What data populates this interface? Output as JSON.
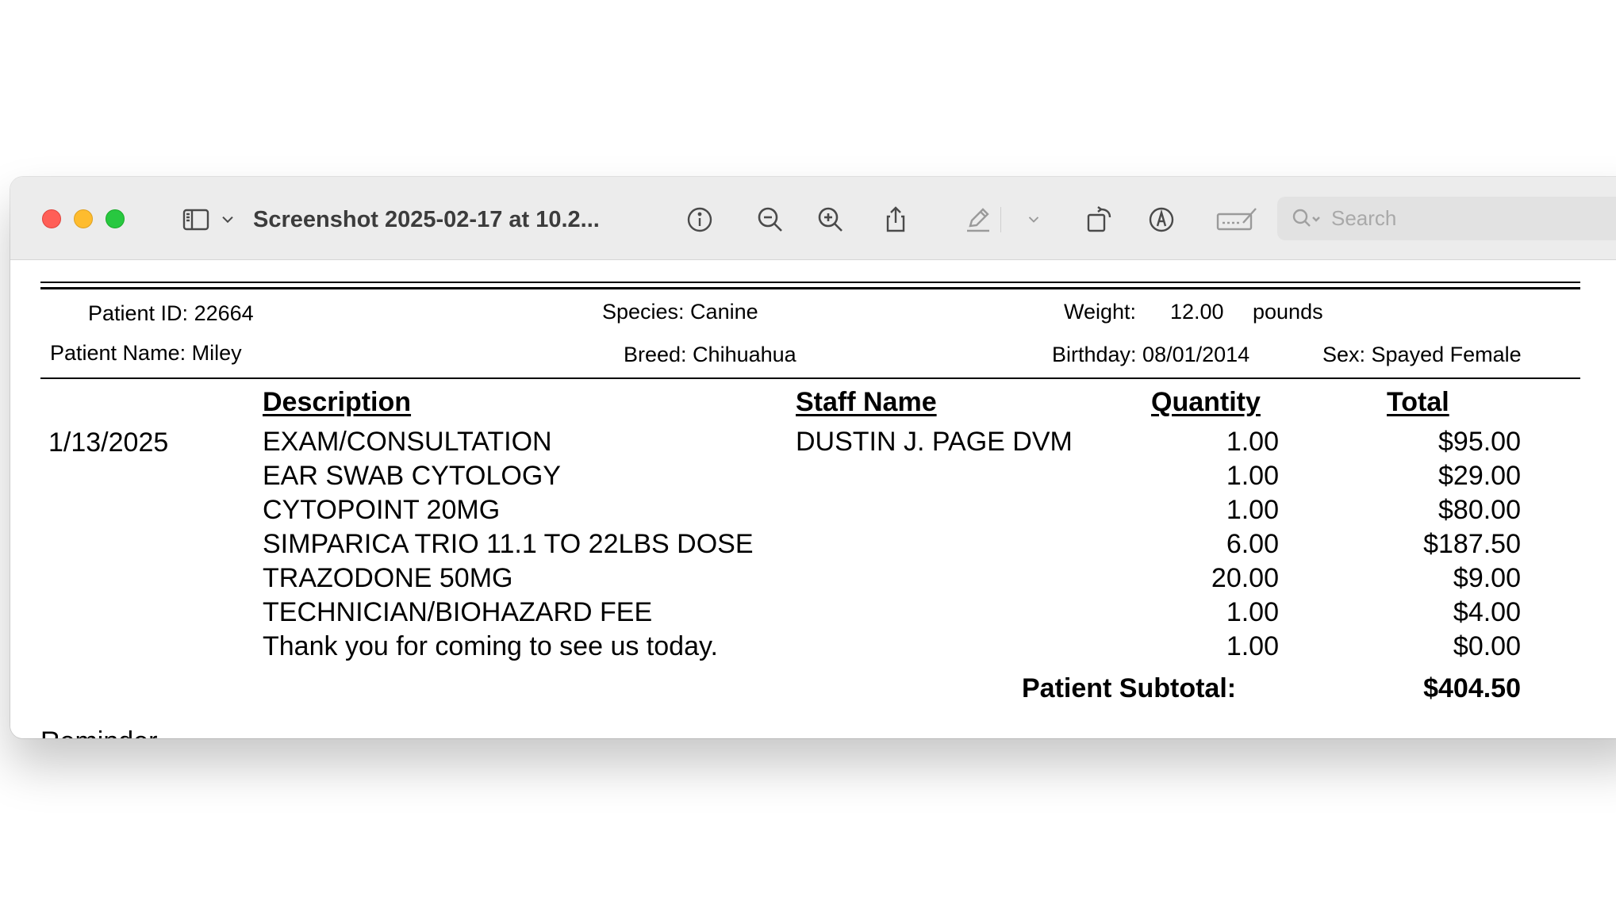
{
  "window": {
    "title": "Screenshot 2025-02-17 at 10.2...",
    "search_placeholder": "Search"
  },
  "toolbar_icons": [
    "sidebar-icon",
    "chevron-down-icon",
    "info-icon",
    "zoom-out-icon",
    "zoom-in-icon",
    "share-icon",
    "highlight-pen-icon",
    "chevron-down-icon",
    "rotate-icon",
    "markup-icon",
    "signature-icon",
    "search-icon"
  ],
  "patient": {
    "id_label": "Patient ID: 22664",
    "species": "Species: Canine",
    "weight_label": "Weight:",
    "weight_value": "12.00",
    "weight_unit": "pounds",
    "name": "Patient Name: Miley",
    "breed": "Breed: Chihuahua",
    "birthday": "Birthday: 08/01/2014",
    "sex": "Sex: Spayed Female"
  },
  "columns": {
    "description": "Description",
    "staff": "Staff Name",
    "quantity": "Quantity",
    "total": "Total"
  },
  "invoice": {
    "date": "1/13/2025",
    "staff": "DUSTIN J. PAGE DVM",
    "items": [
      {
        "description": "EXAM/CONSULTATION",
        "quantity": "1.00",
        "total": "$95.00"
      },
      {
        "description": "EAR SWAB CYTOLOGY",
        "quantity": "1.00",
        "total": "$29.00"
      },
      {
        "description": "CYTOPOINT 20MG",
        "quantity": "1.00",
        "total": "$80.00"
      },
      {
        "description": "SIMPARICA TRIO 11.1 TO 22LBS DOSE",
        "quantity": "6.00",
        "total": "$187.50"
      },
      {
        "description": "TRAZODONE 50MG",
        "quantity": "20.00",
        "total": "$9.00"
      },
      {
        "description": "TECHNICIAN/BIOHAZARD FEE",
        "quantity": "1.00",
        "total": "$4.00"
      },
      {
        "description": "Thank you for coming to see us today.",
        "quantity": "1.00",
        "total": "$0.00"
      }
    ],
    "subtotal_label": "Patient Subtotal:",
    "subtotal_value": "$404.50"
  },
  "footer_partial": "Reminder",
  "colors": {
    "close": "#ff5f57",
    "minimize": "#febc2e",
    "maximize": "#28c840",
    "titlebar": "#ececec",
    "search_field": "#e2e2e2"
  }
}
